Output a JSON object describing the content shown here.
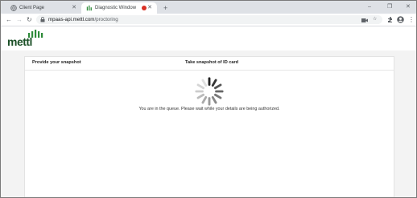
{
  "browser": {
    "tabs": [
      {
        "title": "Client Page",
        "icon": "globe-icon",
        "close": "✕"
      },
      {
        "title": "Diagnostic Window",
        "icon": "mettl-favicon-icon",
        "close": "✕",
        "recording": true
      }
    ],
    "new_tab": "+",
    "window_controls": {
      "minimize": "–",
      "restore": "❐",
      "close": "✕"
    },
    "nav": {
      "back": "←",
      "forward": "→",
      "reload": "↻"
    },
    "address": {
      "host": "mpaas-api.mettl.com",
      "path": "/proctoring"
    },
    "toolbar_icons": [
      "camera-icon",
      "star-icon",
      "extensions-icon",
      "profile-icon",
      "menu-icon"
    ]
  },
  "header": {
    "logo_text": "mettl"
  },
  "card": {
    "left_title": "Provide your snapshot",
    "right_title": "Take snapshot of ID card",
    "message": "You are in the queue. Please wait while your details are being authorized."
  },
  "colors": {
    "brand_green": "#2e8b3a",
    "recording_red": "#d93025",
    "tab_strip": "#dee1e6",
    "page_bg": "#f3f3f3"
  }
}
